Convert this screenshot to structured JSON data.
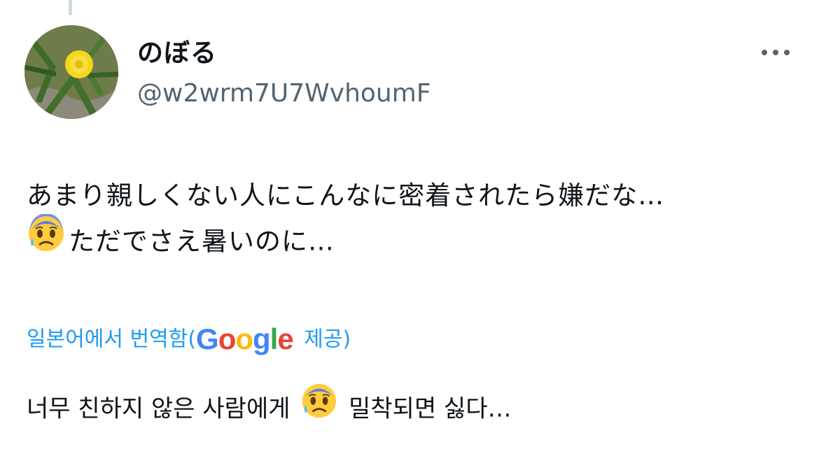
{
  "user": {
    "display_name": "のぼる",
    "handle": "@w2wrm7U7WvhoumF",
    "avatar_icon": "dandelion-photo"
  },
  "actions": {
    "more_icon": "more-horizontal-icon"
  },
  "tweet": {
    "line1": "あまり親しくない人にこんなに密着されたら嫌だな…",
    "line2_emoji": "anxious-face-with-sweat-emoji",
    "line2_text": "ただでさえ暑いのに…"
  },
  "translation": {
    "label_prefix": "일본어에서 번역함(",
    "provider": "Google",
    "label_suffix": " 제공)",
    "text_before": "너무 친하지 않은 사람에게 ",
    "emoji": "anxious-face-with-sweat-emoji",
    "text_after": " 밀착되면 싫다…"
  },
  "colors": {
    "link": "#1d9bf0",
    "secondary_text": "#536471",
    "primary_text": "#0f1419"
  }
}
